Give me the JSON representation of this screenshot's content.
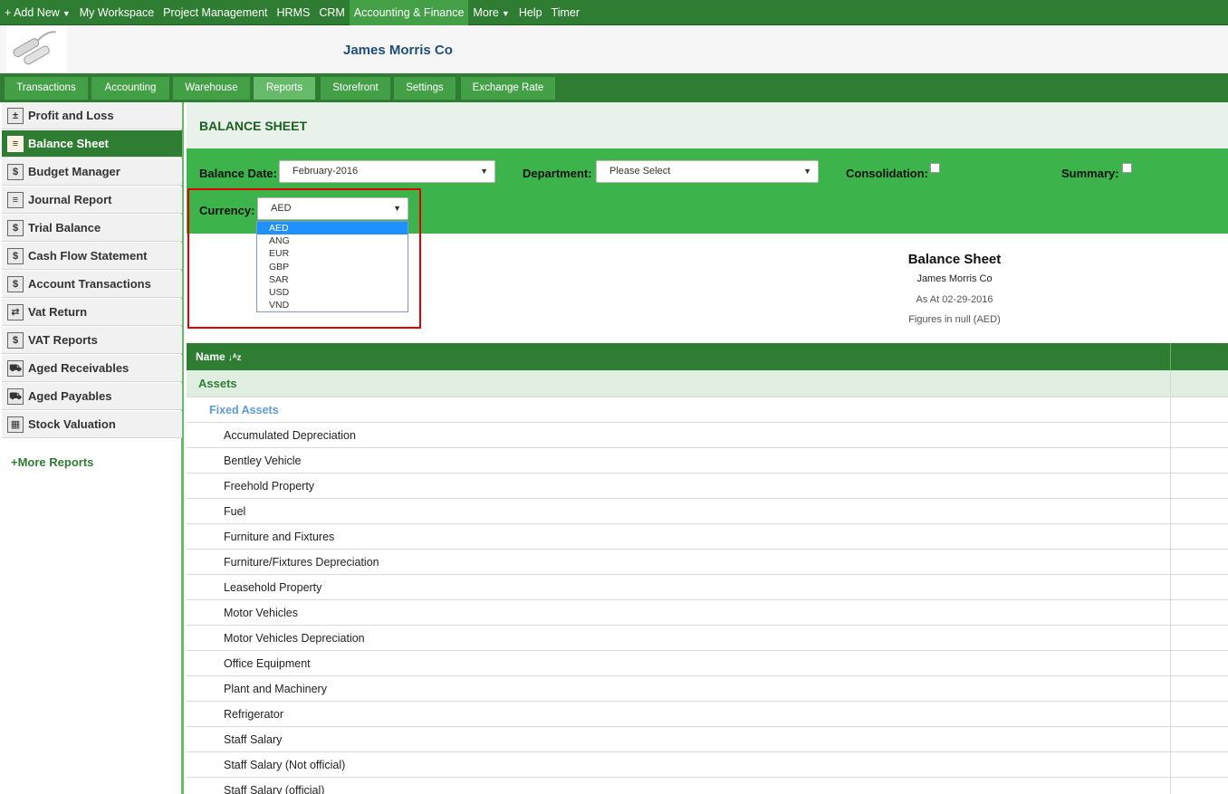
{
  "topnav": {
    "items": [
      {
        "label": "+ Add New",
        "caret": true,
        "active": false
      },
      {
        "label": "My Workspace",
        "caret": false,
        "active": false
      },
      {
        "label": "Project Management",
        "caret": false,
        "active": false
      },
      {
        "label": "HRMS",
        "caret": false,
        "active": false
      },
      {
        "label": "CRM",
        "caret": false,
        "active": false
      },
      {
        "label": "Accounting & Finance",
        "caret": false,
        "active": true
      },
      {
        "label": "More",
        "caret": true,
        "active": false
      },
      {
        "label": "Help",
        "caret": false,
        "active": false
      },
      {
        "label": "Timer",
        "caret": false,
        "active": false
      }
    ]
  },
  "header": {
    "company": "James Morris Co"
  },
  "tabs": [
    {
      "label": "Transactions",
      "active": false
    },
    {
      "label": "Accounting",
      "active": false
    },
    {
      "label": "Warehouse",
      "active": false
    },
    {
      "label": "Reports",
      "active": true
    },
    {
      "label": "Storefront",
      "active": false
    },
    {
      "label": "Settings",
      "active": false
    },
    {
      "label": "Exchange Rate",
      "active": false
    }
  ],
  "sidebar": {
    "items": [
      {
        "label": "Profit and Loss",
        "icon": "calculator-icon",
        "active": false
      },
      {
        "label": "Balance Sheet",
        "icon": "balance-sheet-icon",
        "active": true
      },
      {
        "label": "Budget Manager",
        "icon": "budget-icon",
        "active": false
      },
      {
        "label": "Journal Report",
        "icon": "journal-icon",
        "active": false
      },
      {
        "label": "Trial Balance",
        "icon": "dollar-icon",
        "active": false
      },
      {
        "label": "Cash Flow Statement",
        "icon": "dollar-icon",
        "active": false
      },
      {
        "label": "Account Transactions",
        "icon": "transactions-icon",
        "active": false
      },
      {
        "label": "Vat Return",
        "icon": "vat-return-icon",
        "active": false
      },
      {
        "label": "VAT Reports",
        "icon": "vat-reports-icon",
        "active": false
      },
      {
        "label": "Aged Receivables",
        "icon": "receivables-icon",
        "active": false
      },
      {
        "label": "Aged Payables",
        "icon": "payables-icon",
        "active": false
      },
      {
        "label": "Stock Valuation",
        "icon": "stock-icon",
        "active": false
      }
    ],
    "more": "+More Reports"
  },
  "main": {
    "title": "BALANCE SHEET",
    "filters": {
      "balance_date_label": "Balance Date:",
      "balance_date_value": "February-2016",
      "department_label": "Department:",
      "department_value": "Please Select",
      "consolidation_label": "Consolidation:",
      "summary_label": "Summary:",
      "currency_label": "Currency:",
      "currency_value": "AED",
      "currency_options": [
        "AED",
        "ANG",
        "EUR",
        "GBP",
        "SAR",
        "USD",
        "VND"
      ]
    },
    "report": {
      "title": "Balance Sheet",
      "company": "James Morris Co",
      "as_at": "As At 02-29-2016",
      "figures": "Figures in null (AED)"
    },
    "table": {
      "header_name": "Name",
      "group": "Assets",
      "subgroup": "Fixed Assets",
      "accounts": [
        "Accumulated Depreciation",
        "Bentley Vehicle",
        "Freehold Property",
        "Fuel",
        "Furniture and Fixtures",
        "Furniture/Fixtures Depreciation",
        "Leasehold Property",
        "Motor Vehicles",
        "Motor Vehicles Depreciation",
        "Office Equipment",
        "Plant and Machinery",
        "Refrigerator",
        "Staff Salary",
        "Staff Salary (Not official)",
        "Staff Salary (official)"
      ]
    }
  }
}
